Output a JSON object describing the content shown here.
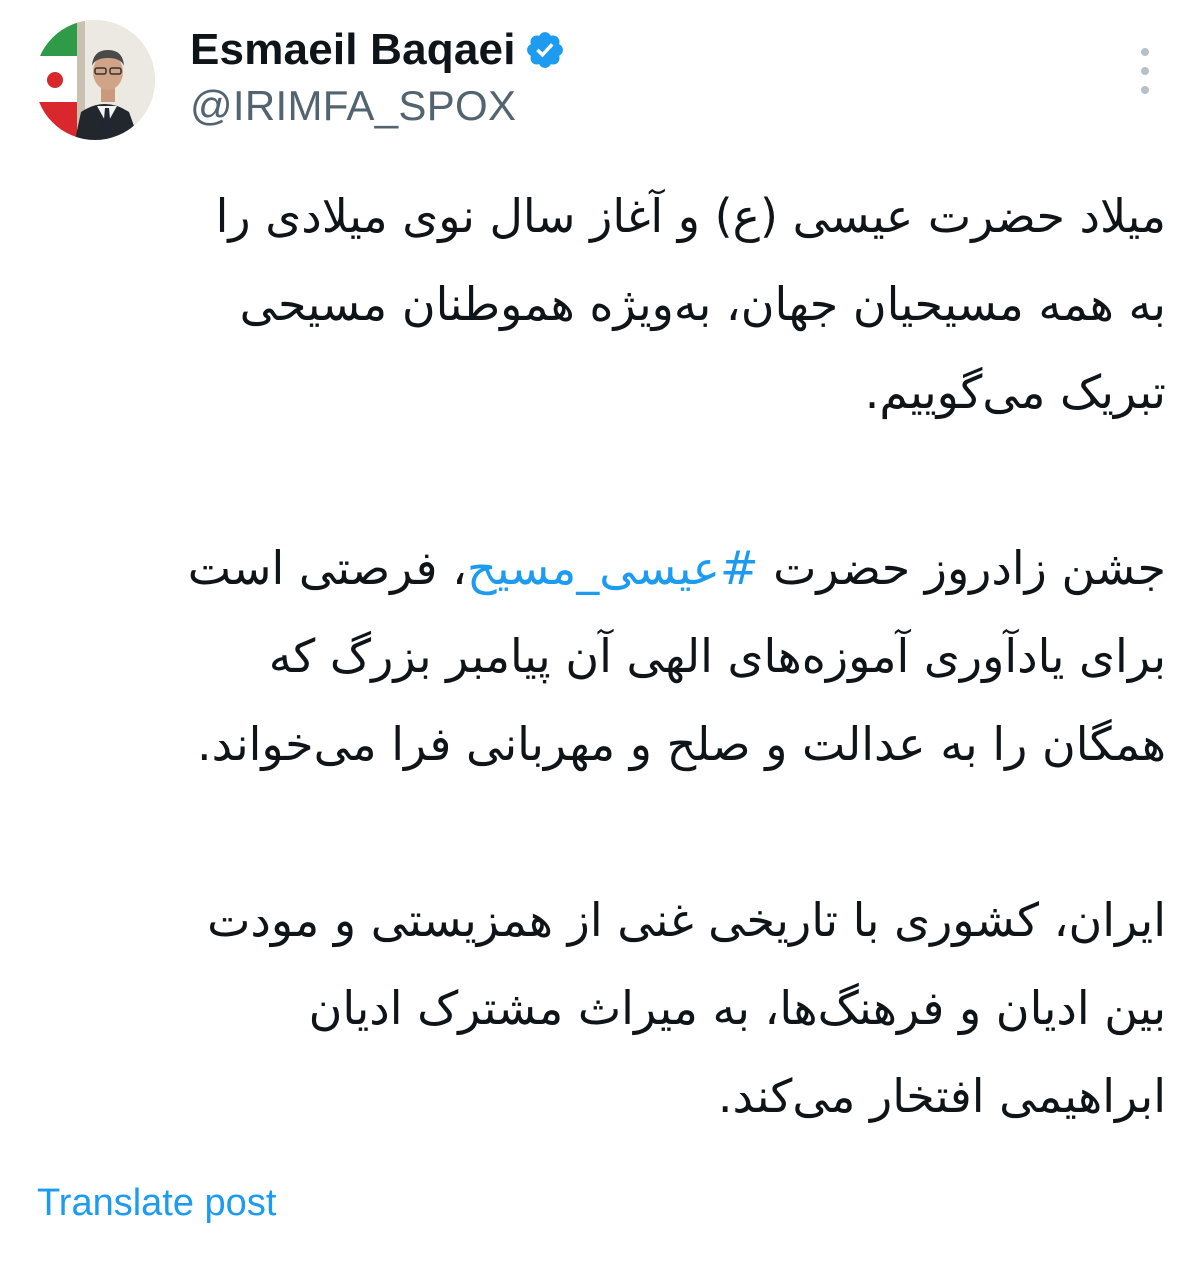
{
  "author": {
    "display_name": "Esmaeil Baqaei",
    "handle": "@IRIMFA_SPOX",
    "verified": true
  },
  "icons": {
    "avatar": "avatar",
    "verified": "verified-badge-icon",
    "more": "more-options-icon"
  },
  "colors": {
    "link": "#1d9bf0",
    "text": "#0f1419",
    "secondary": "#536471"
  },
  "body": {
    "p1": {
      "l1": "میلاد حضرت عیسی (ع) و آغاز سال نوی میلادی را",
      "l2": "به همه مسیحیان جهان، به‌ویژه هموطنان مسیحی",
      "l3": "تبریک می‌گوییم."
    },
    "p2": {
      "l1_before": "جشن زادروز حضرت ",
      "l1_hashtag": "#عیسی_مسیح",
      "l1_after": "، فرصتی است",
      "l2": "برای یادآوری آموزه‌های الهی آن پیامبر بزرگ که",
      "l3": "همگان را به عدالت و صلح و مهربانی فرا می‌خواند."
    },
    "p3": {
      "l1": "ایران، کشوری با تاریخی غنی از همزیستی و مودت",
      "l2": "بین ادیان و فرهنگ‌ها، به میراث مشترک ادیان",
      "l3": "ابراهیمی افتخار می‌کند."
    }
  },
  "translate_label": "Translate post"
}
